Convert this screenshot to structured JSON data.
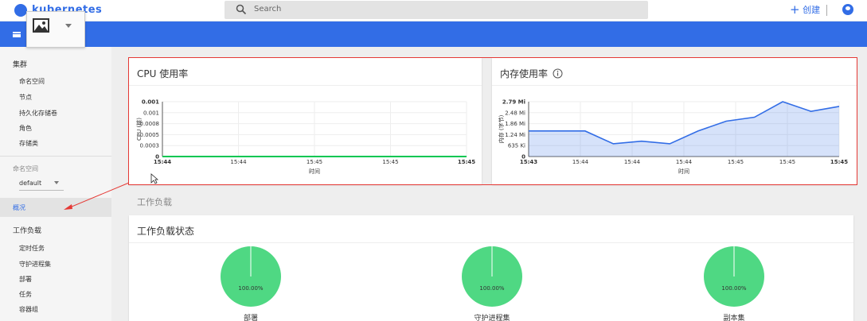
{
  "header": {
    "brand": "kubernetes",
    "search_placeholder": "Search",
    "create_label": "创建"
  },
  "sidebar": {
    "cluster_header": "集群",
    "cluster_items": [
      "命名空间",
      "节点",
      "持久化存储卷",
      "角色",
      "存储类"
    ],
    "namespace_label": "命名空间",
    "namespace_value": "default",
    "overview": "概况",
    "workloads_header": "工作负载",
    "workload_items": [
      "定时任务",
      "守护进程集",
      "部署",
      "任务",
      "容器组"
    ]
  },
  "cpu_card": {
    "title": "CPU 使用率",
    "ylabel": "CPU (核)",
    "xlabel": "时间",
    "chart_data": {
      "type": "line",
      "title": "CPU 使用率",
      "xlabel": "时间",
      "ylabel": "CPU (核)",
      "y_ticks": [
        "0",
        "0.0003",
        "0.0005",
        "0.0008",
        "0.001",
        "0.001"
      ],
      "x_ticks": [
        "15:44",
        "15:44",
        "15:45",
        "15:45",
        "15:45"
      ],
      "ylim": [
        0,
        0.001
      ],
      "series": [
        {
          "values": [
            0,
            0,
            0,
            0,
            0,
            0,
            0,
            0,
            0,
            0,
            0,
            0
          ]
        }
      ],
      "color": "#00c752"
    }
  },
  "mem_card": {
    "title": "内存使用率",
    "ylabel": "内存 (字节)",
    "xlabel": "时间",
    "chart_data": {
      "type": "area",
      "title": "内存使用率",
      "xlabel": "时间",
      "ylabel": "内存 (字节)",
      "y_ticks": [
        "0",
        "635 Ki",
        "1.24 Mi",
        "1.86 Mi",
        "2.48 Mi",
        "2.79 Mi"
      ],
      "x_ticks": [
        "15:43",
        "15:44",
        "15:44",
        "15:44",
        "15:45",
        "15:45",
        "15:45"
      ],
      "ylim": [
        0,
        2.79
      ],
      "series": [
        {
          "values": [
            1.3,
            1.3,
            1.3,
            0.65,
            0.78,
            0.65,
            1.3,
            1.8,
            2.0,
            2.79,
            2.3,
            2.55
          ]
        }
      ],
      "color": "#326de6"
    }
  },
  "workloads": {
    "section_title": "工作负载",
    "status_title": "工作负载状态",
    "pies": [
      {
        "percent": "100.00%",
        "label": "部署"
      },
      {
        "percent": "100.00%",
        "label": "守护进程集"
      },
      {
        "percent": "100.00%",
        "label": "副本集"
      }
    ],
    "pie_color": "#4fd883"
  }
}
